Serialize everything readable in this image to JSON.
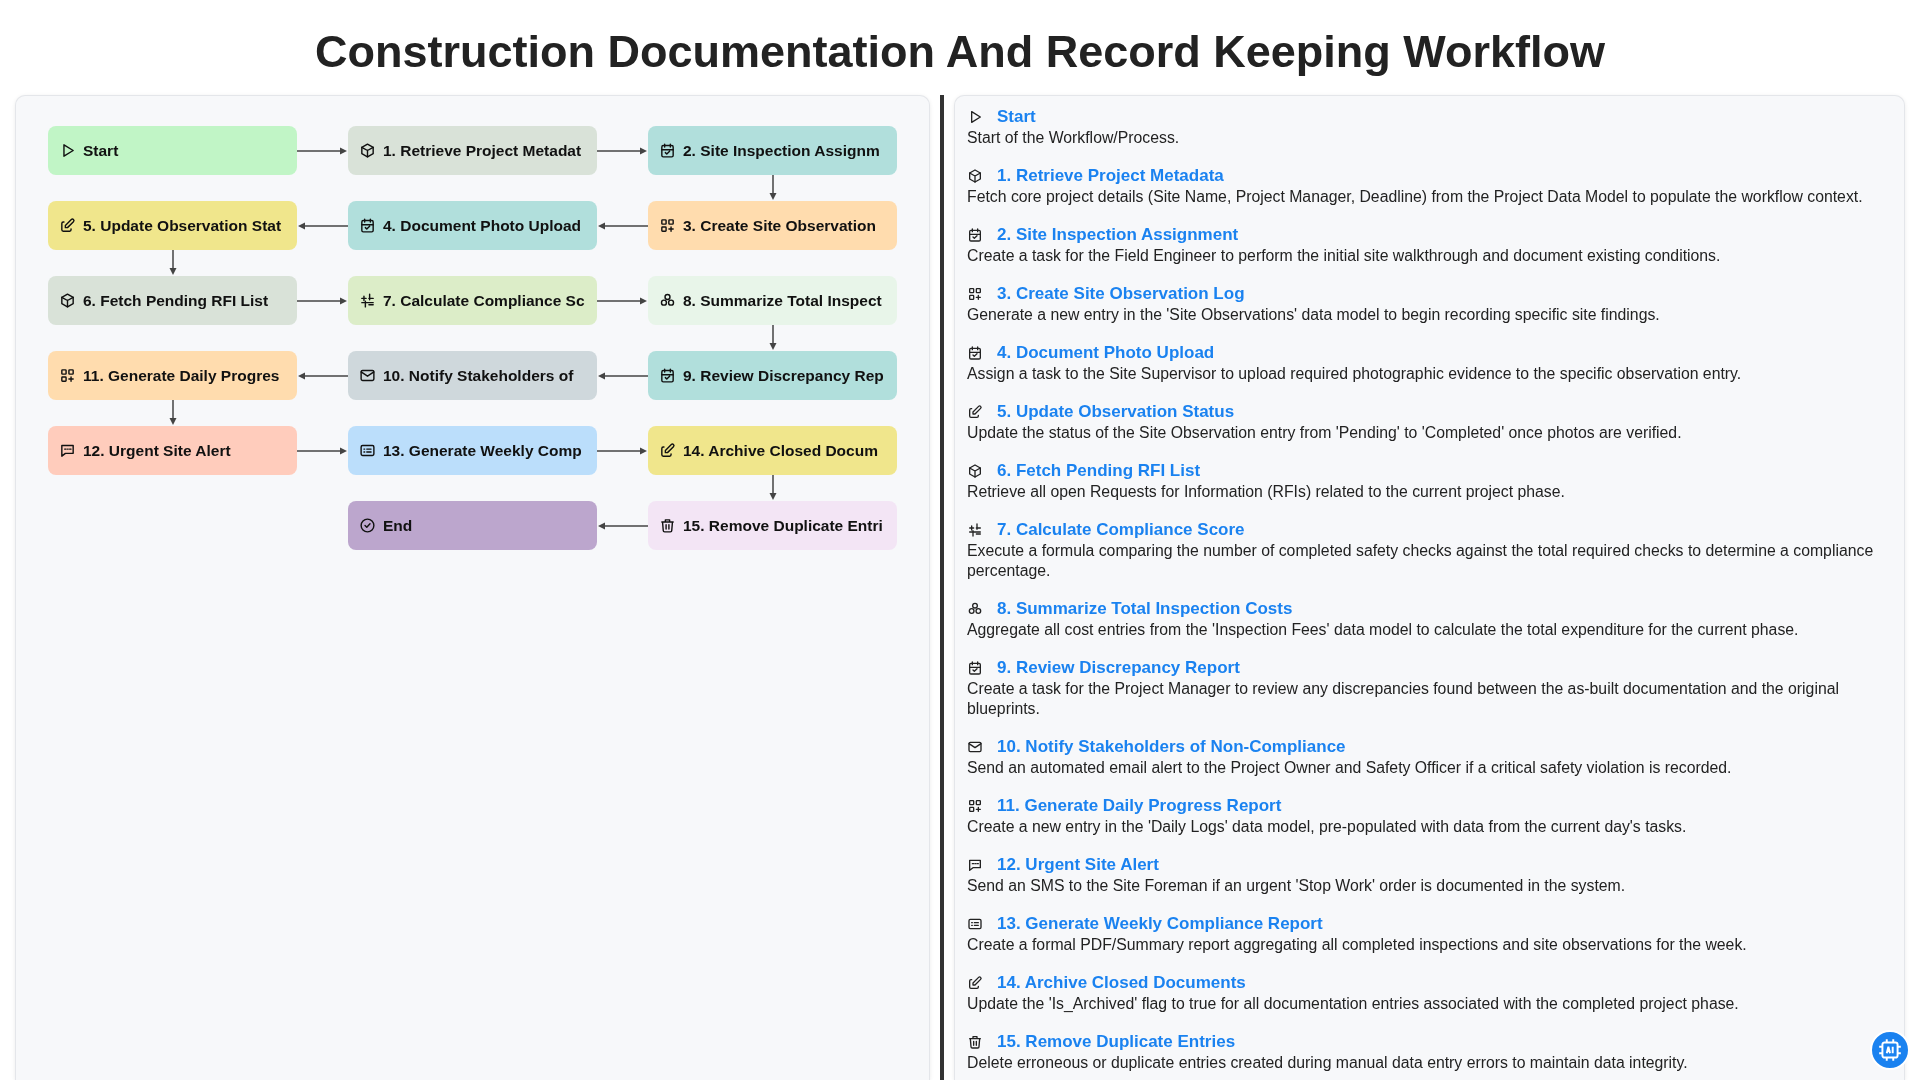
{
  "title": "Construction Documentation And Record Keeping Workflow",
  "nodes": [
    {
      "label": "Start",
      "kind": "play",
      "color": "#c1f5c6"
    },
    {
      "label": "1. Retrieve Project Metadat",
      "kind": "cube",
      "color": "#d9e2d8"
    },
    {
      "label": "2. Site Inspection Assignm",
      "kind": "calendar-check",
      "color": "#b1dfdc"
    },
    {
      "label": "5. Update Observation Stat",
      "kind": "edit",
      "color": "#f0e68c"
    },
    {
      "label": "4. Document Photo Upload",
      "kind": "calendar-check",
      "color": "#b1dfdc"
    },
    {
      "label": "3. Create Site Observation",
      "kind": "apps-plus",
      "color": "#ffdcae"
    },
    {
      "label": "6. Fetch Pending RFI List",
      "kind": "cube",
      "color": "#d9e2d8"
    },
    {
      "label": "7. Calculate Compliance Sc",
      "kind": "formula",
      "color": "#dcedc8"
    },
    {
      "label": "8. Summarize Total Inspect",
      "kind": "boxes",
      "color": "#e8f5e9"
    },
    {
      "label": "11. Generate Daily Progres",
      "kind": "apps-plus",
      "color": "#ffdcae"
    },
    {
      "label": "10. Notify Stakeholders of",
      "kind": "mail",
      "color": "#cfd8dc"
    },
    {
      "label": "9. Review Discrepancy Rep",
      "kind": "calendar-check",
      "color": "#b1dfdc"
    },
    {
      "label": "12. Urgent Site Alert",
      "kind": "sms",
      "color": "#ffccbc"
    },
    {
      "label": "13. Generate Weekly Comp",
      "kind": "list",
      "color": "#bbdefb"
    },
    {
      "label": "14. Archive Closed Docum",
      "kind": "edit",
      "color": "#f0e68c"
    },
    {
      "label": "End",
      "kind": "check-circle",
      "color": "#bca6cd"
    },
    {
      "label": "15. Remove Duplicate Entri",
      "kind": "trash",
      "color": "#f3e5f5"
    }
  ],
  "details": [
    {
      "title": "Start",
      "kind": "play",
      "text": "Start of the Workflow/Process."
    },
    {
      "title": "1. Retrieve Project Metadata",
      "kind": "cube",
      "text": "Fetch core project details (Site Name, Project Manager, Deadline) from the Project Data Model to populate the workflow context."
    },
    {
      "title": "2. Site Inspection Assignment",
      "kind": "calendar-check",
      "text": "Create a task for the Field Engineer to perform the initial site walkthrough and document existing conditions."
    },
    {
      "title": "3. Create Site Observation Log",
      "kind": "apps-plus",
      "text": "Generate a new entry in the 'Site Observations' data model to begin recording specific site findings."
    },
    {
      "title": "4. Document Photo Upload",
      "kind": "calendar-check",
      "text": "Assign a task to the Site Supervisor to upload required photographic evidence to the specific observation entry."
    },
    {
      "title": "5. Update Observation Status",
      "kind": "edit",
      "text": "Update the status of the Site Observation entry from 'Pending' to 'Completed' once photos are verified."
    },
    {
      "title": "6. Fetch Pending RFI List",
      "kind": "cube",
      "text": "Retrieve all open Requests for Information (RFIs) related to the current project phase."
    },
    {
      "title": "7. Calculate Compliance Score",
      "kind": "formula",
      "text": "Execute a formula comparing the number of completed safety checks against the total required checks to determine a compliance percentage."
    },
    {
      "title": "8. Summarize Total Inspection Costs",
      "kind": "boxes",
      "text": "Aggregate all cost entries from the 'Inspection Fees' data model to calculate the total expenditure for the current phase."
    },
    {
      "title": "9. Review Discrepancy Report",
      "kind": "calendar-check",
      "text": "Create a task for the Project Manager to review any discrepancies found between the as-built documentation and the original blueprints."
    },
    {
      "title": "10. Notify Stakeholders of Non-Compliance",
      "kind": "mail",
      "text": "Send an automated email alert to the Project Owner and Safety Officer if a critical safety violation is recorded."
    },
    {
      "title": "11. Generate Daily Progress Report",
      "kind": "apps-plus",
      "text": "Create a new entry in the 'Daily Logs' data model, pre-populated with data from the current day's tasks."
    },
    {
      "title": "12. Urgent Site Alert",
      "kind": "sms",
      "text": "Send an SMS to the Site Foreman if an urgent 'Stop Work' order is documented in the system."
    },
    {
      "title": "13. Generate Weekly Compliance Report",
      "kind": "list",
      "text": "Create a formal PDF/Summary report aggregating all completed inspections and site observations for the week."
    },
    {
      "title": "14. Archive Closed Documents",
      "kind": "edit",
      "text": "Update the 'Is_Archived' flag to true for all documentation entries associated with the completed project phase."
    },
    {
      "title": "15. Remove Duplicate Entries",
      "kind": "trash",
      "text": "Delete erroneous or duplicate entries created during manual data entry errors to maintain data integrity."
    }
  ]
}
